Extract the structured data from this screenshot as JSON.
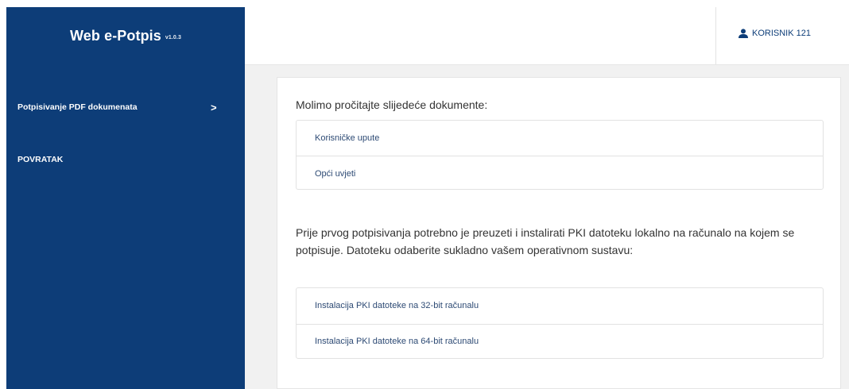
{
  "brand": {
    "title": "Web e-Potpis",
    "version": "v1.0.3"
  },
  "sidebar": {
    "items": [
      {
        "label": "Potpisivanje PDF dokumenata",
        "chevron": ">"
      },
      {
        "label": "POVRATAK"
      }
    ]
  },
  "header": {
    "user_label": "KORISNIK 121",
    "user_icon": "user-icon"
  },
  "main": {
    "intro": "Molimo pročitajte slijedeće dokumente:",
    "documents": [
      "Korisničke upute",
      "Opći uvjeti"
    ],
    "notice": "Prije prvog potpisivanja potrebno je preuzeti i instalirati PKI datoteku lokalno na računalo na kojem se potpisuje. Datoteku odaberite sukladno vašem operativnom sustavu:",
    "pki_links": [
      "Instalacija PKI datoteke na 32-bit računalu",
      "Instalacija PKI datoteke na 64-bit računalu"
    ]
  },
  "colors": {
    "sidebar": "#0d3d78",
    "content_bg": "#f1f1f1",
    "link": "#2d4a74"
  }
}
